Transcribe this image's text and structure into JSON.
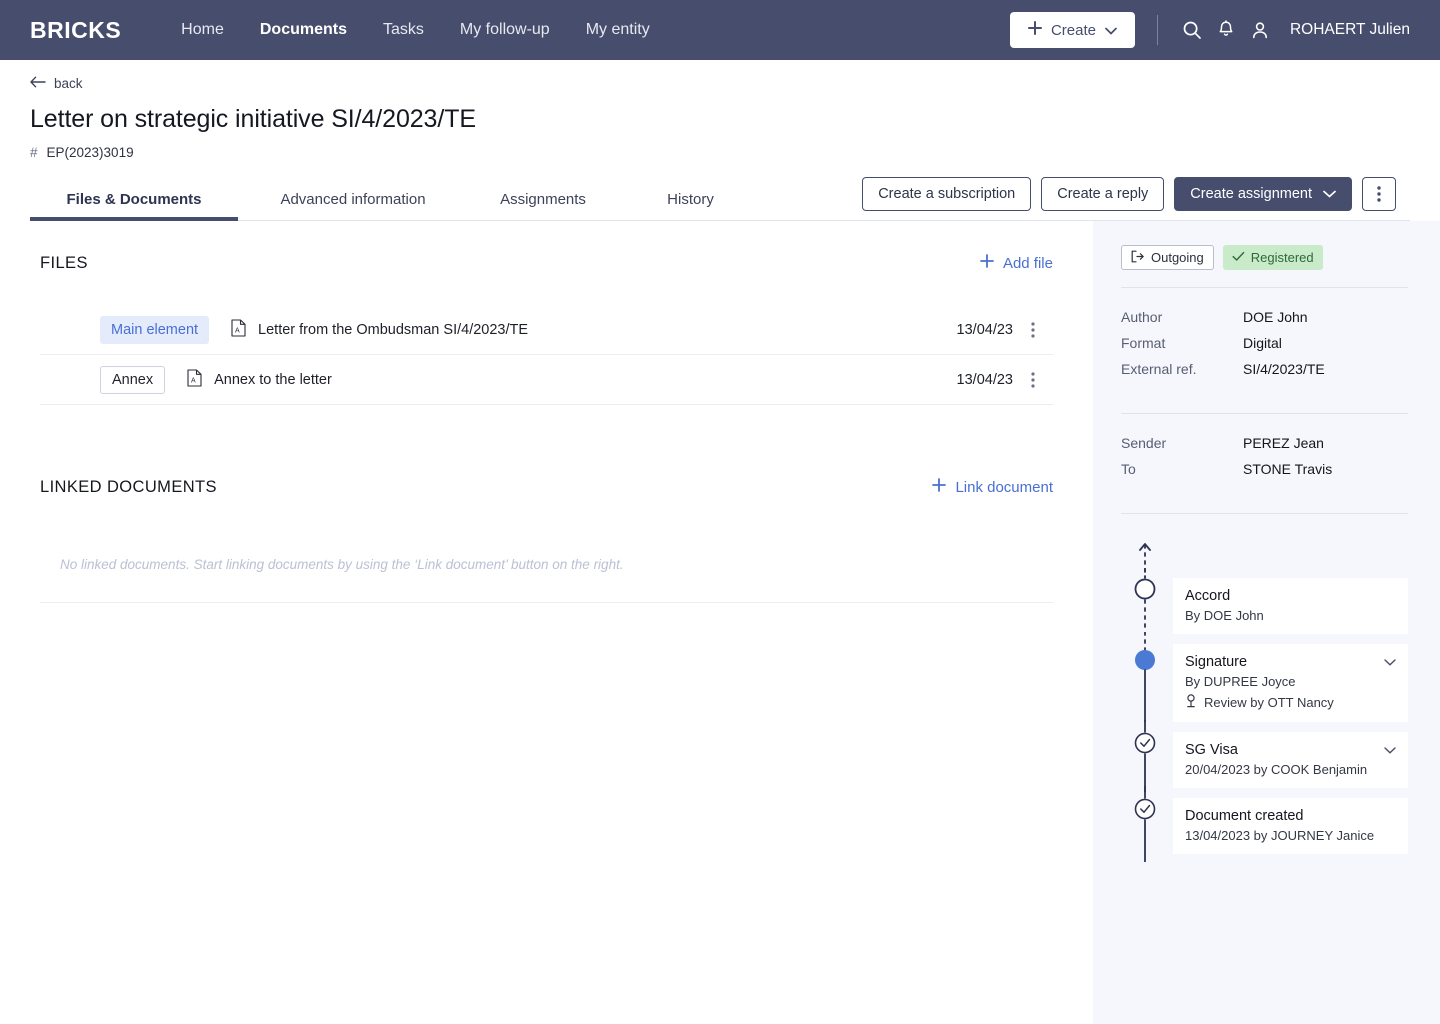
{
  "nav": {
    "brand": "BRICKS",
    "links": [
      {
        "label": "Home",
        "active": false
      },
      {
        "label": "Documents",
        "active": true
      },
      {
        "label": "Tasks",
        "active": false
      },
      {
        "label": "My follow-up",
        "active": false
      },
      {
        "label": "My entity",
        "active": false
      }
    ],
    "create_label": "Create",
    "user": "ROHAERT Julien",
    "icons": [
      "search-icon",
      "bell-icon",
      "user-icon"
    ]
  },
  "page": {
    "back_label": "back",
    "title": "Letter on strategic initiative SI/4/2023/TE",
    "hash_symbol": "#",
    "reference": "EP(2023)3019"
  },
  "tabs": [
    {
      "label": "Files & Documents",
      "active": true
    },
    {
      "label": "Advanced information",
      "active": false
    },
    {
      "label": "Assignments",
      "active": false
    },
    {
      "label": "History",
      "active": false
    }
  ],
  "actions": {
    "subscription": "Create a subscription",
    "reply": "Create a reply",
    "assignment": "Create assignment"
  },
  "files_section": {
    "title": "FILES",
    "add_label": "Add file",
    "rows": [
      {
        "chip": "Main element",
        "chip_type": "main",
        "name": "Letter from the Ombudsman SI/4/2023/TE",
        "date": "13/04/23"
      },
      {
        "chip": "Annex",
        "chip_type": "annex",
        "name": "Annex to the letter",
        "date": "13/04/23"
      }
    ]
  },
  "linked_section": {
    "title": "LINKED DOCUMENTS",
    "link_label": "Link document",
    "empty_text": "No linked documents. Start linking documents by using the ‘Link document’ button on the right."
  },
  "sidebar": {
    "badges": [
      {
        "label": "Outgoing",
        "style": "outline",
        "icon": "outgoing-arrow-icon"
      },
      {
        "label": "Registered",
        "style": "green",
        "icon": "check-icon"
      }
    ],
    "meta_primary": [
      {
        "key": "Author",
        "value": "DOE John"
      },
      {
        "key": "Format",
        "value": "Digital"
      },
      {
        "key": "External ref.",
        "value": "SI/4/2023/TE"
      }
    ],
    "meta_secondary": [
      {
        "key": "Sender",
        "value": "PEREZ Jean"
      },
      {
        "key": "To",
        "value": "STONE Travis"
      }
    ],
    "timeline": [
      {
        "title": "Accord",
        "subtitle": "By DOE John",
        "marker": "hollow-circle",
        "line_above": "dashed",
        "line_below": "dashed",
        "chevron": false,
        "review": null
      },
      {
        "title": "Signature",
        "subtitle": "By DUPREE Joyce",
        "marker": "filled-dot",
        "line_above": "dashed",
        "line_below": "solid",
        "chevron": true,
        "review": "Review by OTT Nancy"
      },
      {
        "title": "SG Visa",
        "subtitle": "20/04/2023 by COOK Benjamin",
        "marker": "check-circle",
        "line_above": "solid",
        "line_below": "solid",
        "chevron": true,
        "review": null
      },
      {
        "title": "Document created",
        "subtitle": "13/04/2023 by JOURNEY Janice",
        "marker": "check-circle",
        "line_above": "solid",
        "line_below": "solid",
        "chevron": false,
        "review": null
      }
    ]
  },
  "colors": {
    "navy": "#474D6D",
    "link_blue": "#4a6fd4",
    "chip_blue_bg": "#e4ecfb",
    "badge_green_bg": "#c9ebc9",
    "badge_green_text": "#2c6b35",
    "sidebar_bg": "#f5f7fc",
    "timeline_active": "#4a7ad4"
  }
}
